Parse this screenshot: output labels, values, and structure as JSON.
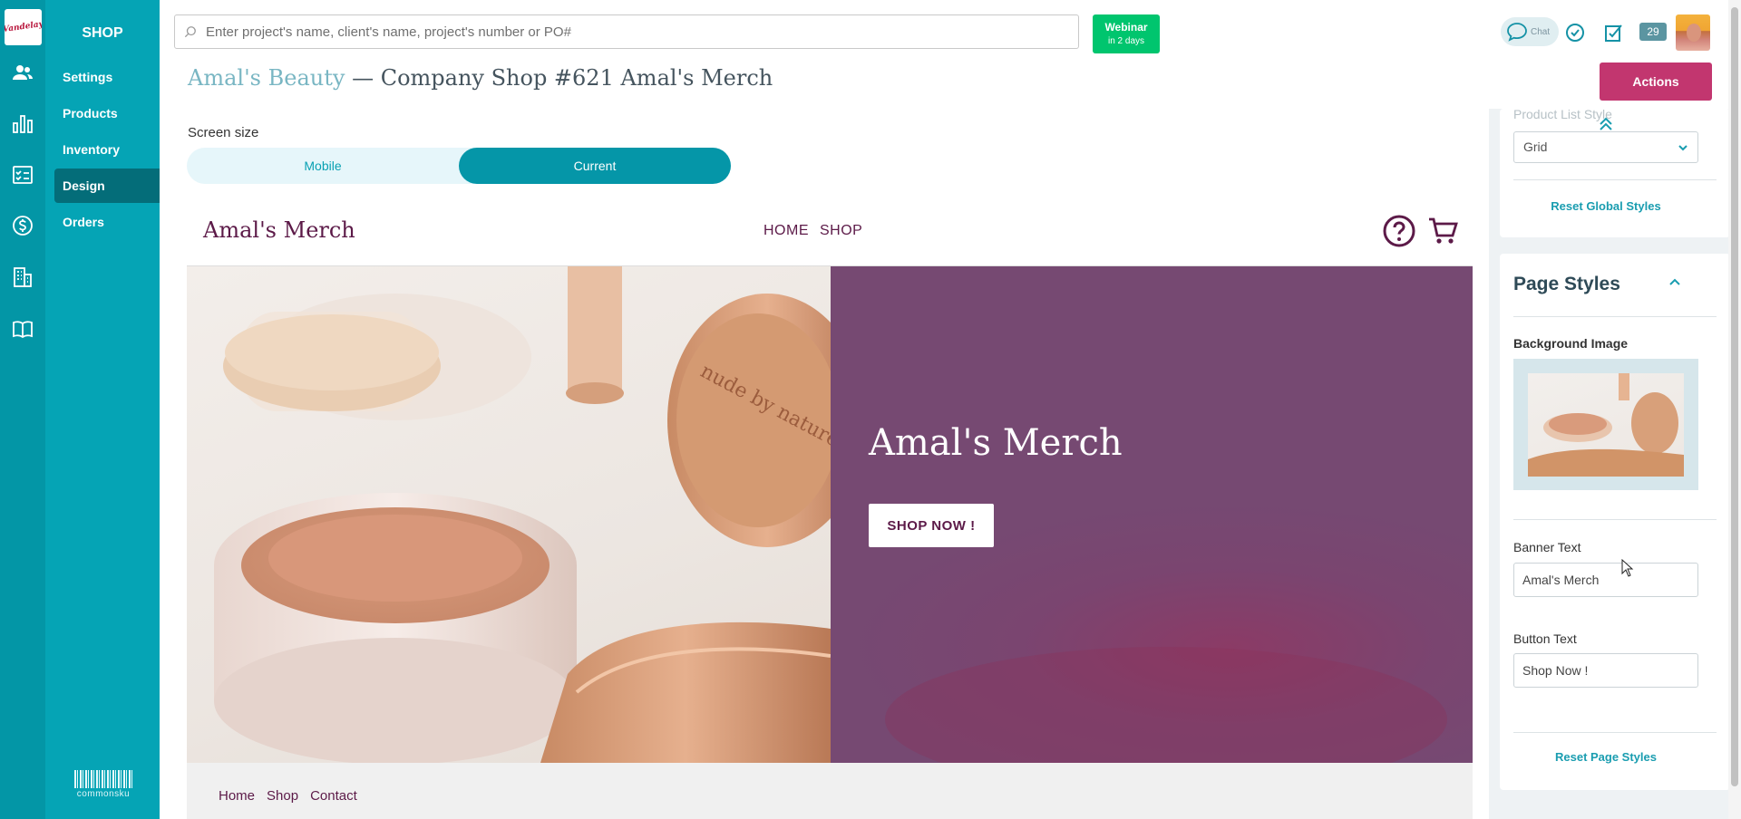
{
  "app": {
    "logo_text": "Vandelay"
  },
  "rail": [
    "users-icon",
    "bar-chart-icon",
    "checklist-icon",
    "dollar-icon",
    "building-icon",
    "book-icon"
  ],
  "shopnav": {
    "title": "SHOP",
    "items": [
      {
        "label": "Settings",
        "active": false
      },
      {
        "label": "Products",
        "active": false
      },
      {
        "label": "Inventory",
        "active": false
      },
      {
        "label": "Design",
        "active": true
      },
      {
        "label": "Orders",
        "active": false
      }
    ],
    "brand": "commonsku"
  },
  "header": {
    "search_placeholder": "Enter project's name, client's name, project's number or PO#",
    "webinar_title": "Webinar",
    "webinar_sub": "in 2 days",
    "chat_label": "Chat",
    "notifications_count": "29"
  },
  "page": {
    "client": "Amal's Beauty",
    "separator": " — ",
    "title": "Company Shop #621 Amal's Merch",
    "actions_label": "Actions"
  },
  "preview": {
    "screen_size_label": "Screen size",
    "options": {
      "mobile": "Mobile",
      "current": "Current"
    },
    "selected": "Current",
    "site": {
      "logo": "Amal's Merch",
      "menu": [
        "HOME",
        "SHOP"
      ],
      "hero_title": "Amal's Merch",
      "hero_button": "SHOP NOW !",
      "footer_links": [
        "Home",
        "Shop",
        "Contact"
      ],
      "accent": "#5c1a48",
      "banner_color": "#764972"
    }
  },
  "panel": {
    "product_list_style_label": "Product List Style",
    "product_list_style_value": "Grid",
    "reset_global": "Reset Global Styles",
    "page_styles_title": "Page Styles",
    "background_image_label": "Background Image",
    "banner_text_label": "Banner Text",
    "banner_text_value": "Amal's Merch",
    "button_text_label": "Button Text",
    "button_text_value": "Shop Now !",
    "reset_page": "Reset Page Styles"
  },
  "colors": {
    "rail": "#0396a6",
    "nav": "#05a4b5",
    "actions": "#c2366f",
    "webinar": "#00c56e"
  }
}
